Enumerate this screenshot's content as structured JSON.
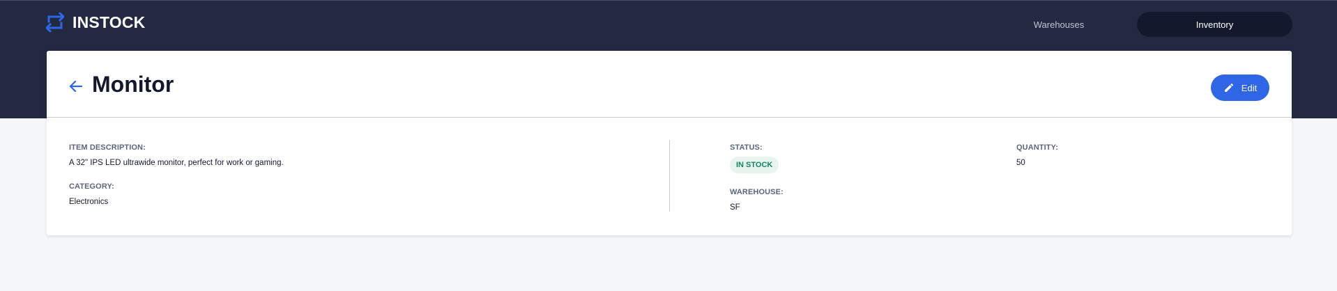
{
  "header": {
    "logo_text": "INSTOCK",
    "nav": {
      "warehouses_label": "Warehouses",
      "inventory_label": "Inventory",
      "active": "Inventory"
    }
  },
  "item": {
    "title": "Monitor",
    "edit_label": "Edit",
    "description_label": "ITEM DESCRIPTION:",
    "description": "A 32\" IPS LED ultrawide monitor, perfect for work or gaming.",
    "category_label": "CATEGORY:",
    "category": "Electronics",
    "status_label": "STATUS:",
    "status": "IN STOCK",
    "warehouse_label": "WAREHOUSE:",
    "warehouse": "SF",
    "quantity_label": "QUANTITY:",
    "quantity": "50"
  },
  "colors": {
    "header_bg": "#232941",
    "nav_active_bg": "#13182c",
    "accent": "#2e66e5",
    "in_stock_text": "#158463",
    "in_stock_bg": "#e8f4ee"
  }
}
